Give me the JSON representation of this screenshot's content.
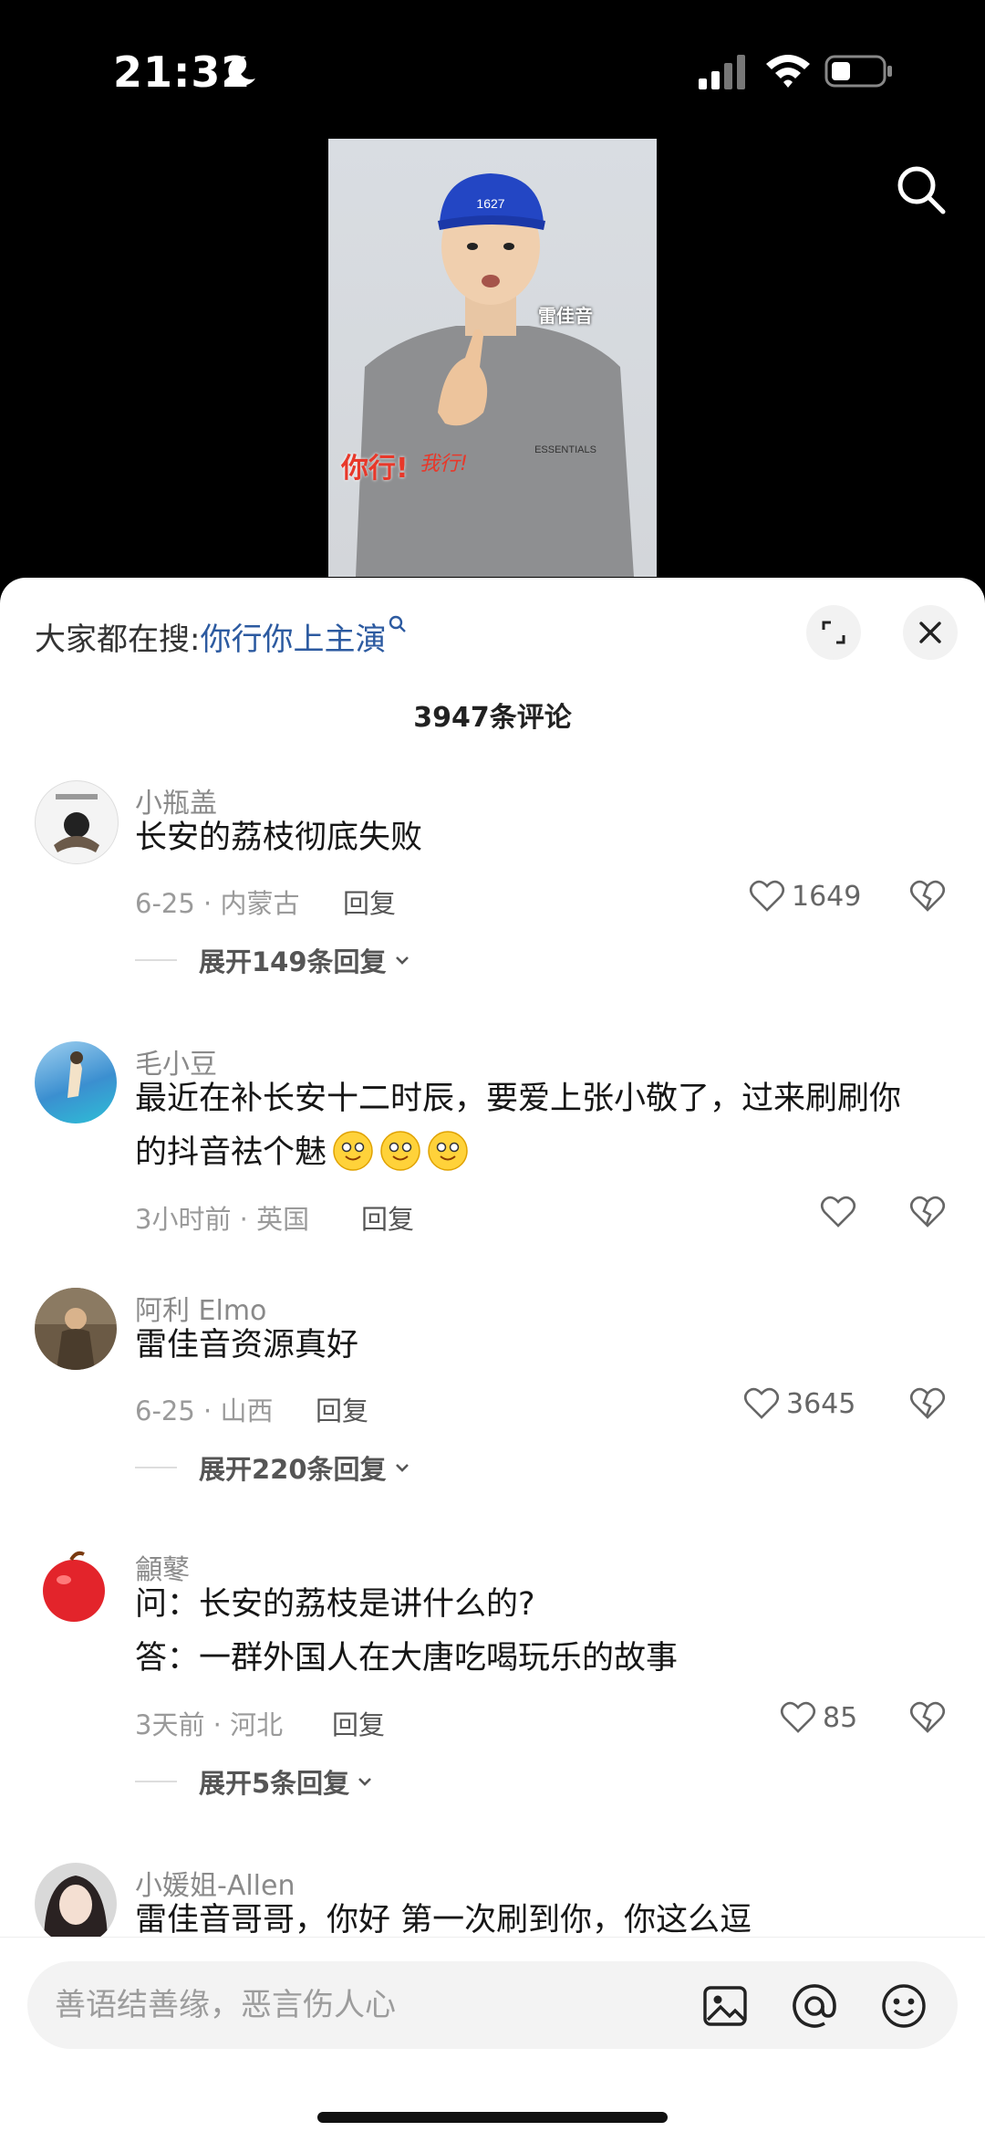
{
  "status_bar": {
    "time": "21:32"
  },
  "video": {
    "overlay_name": "雷佳音",
    "overlay_slogan": "你行!",
    "overlay_slogan2": "我行!"
  },
  "sheet": {
    "hot_search_prefix": "大家都在搜:",
    "hot_search_query": "你行你上主演",
    "comment_count": "3947条评论"
  },
  "comments": [
    {
      "username": "小瓶盖",
      "text": "长安的荔枝彻底失败",
      "meta": "6-25 · 内蒙古",
      "reply_label": "回复",
      "likes": "1649",
      "expand": "展开149条回复"
    },
    {
      "username": "毛小豆",
      "text_line1": "最近在补长安十二时辰，要爱上张小敬了，过来刷刷你",
      "text_line2": "的抖音祛个魅",
      "meta": "3小时前 · 英国",
      "reply_label": "回复",
      "likes": ""
    },
    {
      "username": "阿利 Elmo",
      "text": "雷佳音资源真好",
      "meta": "6-25 · 山西",
      "reply_label": "回复",
      "likes": "3645",
      "expand": "展开220条回复"
    },
    {
      "username": "龥鼕",
      "text_line1": "问：长安的荔枝是讲什么的?",
      "text_line2": "答：一群外国人在大唐吃喝玩乐的故事",
      "meta": "3天前 · 河北",
      "reply_label": "回复",
      "likes": "85",
      "expand": "展开5条回复"
    },
    {
      "username": "小媛姐-Allen",
      "text": "雷佳音哥哥，你好 第一次刷到你，你这么逗"
    }
  ],
  "input_bar": {
    "placeholder": "善语结善缘，恶言伤人心"
  },
  "colors": {
    "link": "#2c5aa0",
    "background": "#ffffff",
    "muted": "#9a9a9a"
  }
}
